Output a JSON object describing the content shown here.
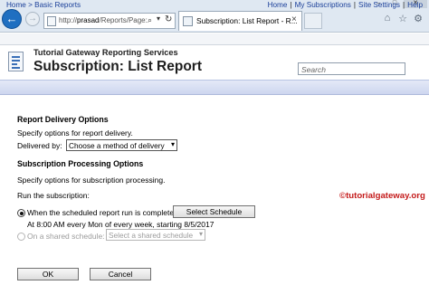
{
  "browser": {
    "address_url_prefix": "http://",
    "address_url_host": "prasad",
    "address_url_path": "/Reports/Page:",
    "tab_title": "Subscription: List Report - R...",
    "tab_close": "×",
    "back_glyph": "←",
    "forward_glyph": "→",
    "search_glyph": "⌕",
    "dropdown_glyph": "▾",
    "refresh_glyph": "↻",
    "home_glyph": "⌂",
    "favorites_glyph": "☆",
    "tools_glyph": "⚙",
    "minimize_glyph": "–",
    "maximize_glyph": "□",
    "close_glyph": "✕"
  },
  "header": {
    "breadcrumb": "Home > Basic Reports",
    "links": [
      "Home",
      "My Subscriptions",
      "Site Settings",
      "Help"
    ],
    "subtitle": "Tutorial Gateway Reporting Services",
    "title": "Subscription: List Report",
    "search_placeholder": "Search"
  },
  "delivery": {
    "heading": "Report Delivery Options",
    "description": "Specify options for report delivery.",
    "delivered_by_label": "Delivered by:",
    "delivered_by_value": "Choose a method of delivery"
  },
  "processing": {
    "heading": "Subscription Processing Options",
    "description": "Specify options for subscription processing.",
    "run_label": "Run the subscription:",
    "option_schedule_label": "When the scheduled report run is complete.",
    "select_schedule_button": "Select Schedule",
    "schedule_summary": "At 8:00 AM every Mon of every week, starting 8/5/2017",
    "option_shared_label": "On a shared schedule:",
    "shared_schedule_value": "Select a shared schedule"
  },
  "actions": {
    "ok": "OK",
    "cancel": "Cancel"
  },
  "watermark": "©tutorialgateway.org",
  "colors": {
    "link": "#1a3f99",
    "band": "#cdd6ef",
    "back_button": "#1f6fc1",
    "watermark": "#c41a1a"
  }
}
